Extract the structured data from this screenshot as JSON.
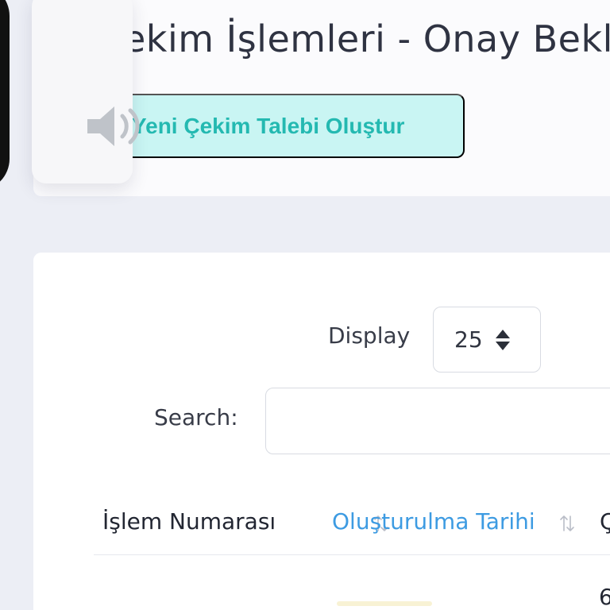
{
  "header": {
    "title": "ekim İşlemleri - Onay Bekli",
    "action_button": "Yeni Çekim Talebi Oluştur",
    "speaker_icon": "speaker-icon"
  },
  "controls": {
    "display_label": "Display",
    "display_value": "25",
    "search_label": "Search:",
    "search_placeholder": ""
  },
  "table": {
    "columns": [
      "İşlem Numarası",
      "Oluşturulma Tarihi",
      "Ç"
    ],
    "visible_row_fragment": "6"
  },
  "colors": {
    "accent": "#3d9be2",
    "button_bg": "#c9f5f3",
    "button_text": "#24b9b1"
  }
}
